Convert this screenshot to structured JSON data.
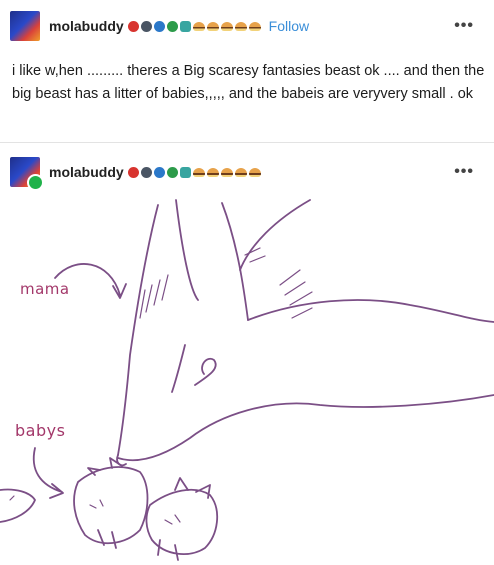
{
  "post1": {
    "username": "molabuddy",
    "follow_label": "Follow",
    "text": "i like w,hen ......... theres a Big scaresy fantasies beast ok .... and then the big beast has a litter of babies,,,,, and the babeis are veryvery small . ok"
  },
  "post2": {
    "username": "molabuddy"
  },
  "icons": {
    "more": "more-options-icon",
    "badges": [
      "red-badge",
      "gray-badge",
      "blue-badge",
      "green-badge",
      "teal-badge",
      "burger-badge",
      "burger-badge",
      "burger-badge",
      "burger-badge",
      "burger-badge"
    ]
  },
  "drawing": {
    "label_mama": "mama",
    "label_babys": "babys",
    "stroke_color": "#7b4f86",
    "label_color": "#a3386a"
  }
}
